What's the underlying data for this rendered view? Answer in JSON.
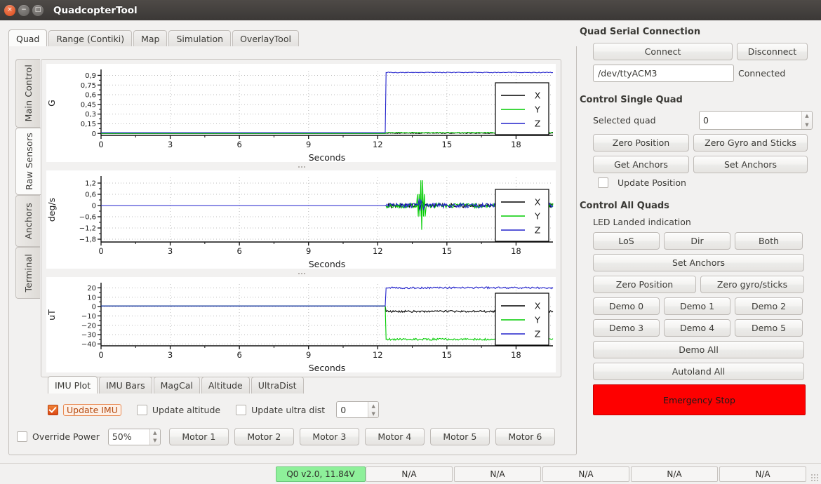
{
  "window": {
    "title": "QuadcopterTool",
    "buttons": {
      "close": "×",
      "minimize": "−",
      "maximize": "□"
    }
  },
  "top_tabs": [
    {
      "label": "Quad",
      "selected": true
    },
    {
      "label": "Range (Contiki)",
      "selected": false
    },
    {
      "label": "Map",
      "selected": false
    },
    {
      "label": "Simulation",
      "selected": false
    },
    {
      "label": "OverlayTool",
      "selected": false
    }
  ],
  "side_tabs": [
    {
      "label": "Main Control",
      "selected": false
    },
    {
      "label": "Raw Sensors",
      "selected": true
    },
    {
      "label": "Anchors",
      "selected": false
    },
    {
      "label": "Terminal",
      "selected": false
    }
  ],
  "bottom_tabs": [
    {
      "label": "IMU Plot",
      "selected": true
    },
    {
      "label": "IMU Bars",
      "selected": false
    },
    {
      "label": "MagCal",
      "selected": false
    },
    {
      "label": "Altitude",
      "selected": false
    },
    {
      "label": "UltraDist",
      "selected": false
    }
  ],
  "update_row": {
    "imu_label": "Update IMU",
    "imu_checked": true,
    "altitude_label": "Update altitude",
    "altitude_checked": false,
    "ultra_label": "Update ultra dist",
    "ultra_checked": false,
    "ultra_value": "0"
  },
  "motor_row": {
    "override_label": "Override Power",
    "override_checked": false,
    "power_value": "50%",
    "motors": [
      "Motor 1",
      "Motor 2",
      "Motor 3",
      "Motor 4",
      "Motor 5",
      "Motor 6"
    ]
  },
  "right_panel": {
    "serial": {
      "title": "Quad Serial Connection",
      "connect": "Connect",
      "disconnect": "Disconnect",
      "port_value": "/dev/ttyACM3",
      "status": "Connected"
    },
    "single": {
      "title": "Control Single Quad",
      "selected_quad_label": "Selected quad",
      "selected_quad_value": "0",
      "zero_position": "Zero Position",
      "zero_gyro_sticks": "Zero Gyro and Sticks",
      "get_anchors": "Get Anchors",
      "set_anchors": "Set Anchors",
      "update_position_label": "Update Position",
      "update_position_checked": false
    },
    "all": {
      "title": "Control All Quads",
      "led_label": "LED Landed indication",
      "los": "LoS",
      "dir": "Dir",
      "both": "Both",
      "set_anchors": "Set Anchors",
      "zero_position": "Zero Position",
      "zero_gyro_sticks": "Zero gyro/sticks",
      "demos": [
        "Demo 0",
        "Demo 1",
        "Demo 2",
        "Demo 3",
        "Demo 4",
        "Demo 5"
      ],
      "demo_all": "Demo All",
      "autoland_all": "Autoland All",
      "emergency_stop": "Emergency Stop",
      "emergency_color": "#fe0000"
    }
  },
  "status_bar": {
    "cells": [
      {
        "text": "Q0 v2.0, 11.84V",
        "ok": true
      },
      {
        "text": "N/A",
        "ok": false
      },
      {
        "text": "N/A",
        "ok": false
      },
      {
        "text": "N/A",
        "ok": false
      },
      {
        "text": "N/A",
        "ok": false
      },
      {
        "text": "N/A",
        "ok": false
      }
    ]
  },
  "chart_data": [
    {
      "type": "line",
      "title": "",
      "xlabel": "Seconds",
      "ylabel": "G",
      "xlim": [
        0,
        19.6
      ],
      "ylim": [
        -0.03,
        0.97
      ],
      "xticks": [
        0,
        3,
        6,
        9,
        12,
        15,
        18
      ],
      "xticklabels": [
        "0",
        "3",
        "6",
        "9",
        "12",
        "15",
        "18"
      ],
      "yticks": [
        0,
        0.15,
        0.3,
        0.45,
        0.6,
        0.75,
        0.9
      ],
      "yticklabels": [
        "0",
        "0,15",
        "0,3",
        "0,45",
        "0,6",
        "0,75",
        "0,9"
      ],
      "grid": true,
      "legend": [
        "X",
        "Y",
        "Z"
      ],
      "legend_position": "lower right",
      "colors": {
        "X": "#000000",
        "Y": "#00cc00",
        "Z": "#2222cc"
      },
      "step_time": 12.35,
      "series": [
        {
          "name": "X",
          "before": 0.0,
          "after": 0.005,
          "noise": 0.006
        },
        {
          "name": "Y",
          "before": 0.0,
          "after": 0.012,
          "noise": 0.006
        },
        {
          "name": "Z",
          "before": 0.012,
          "after": 0.945,
          "noise": 0.006
        }
      ]
    },
    {
      "type": "line",
      "title": "",
      "xlabel": "Seconds",
      "ylabel": "deg/s",
      "xlim": [
        0,
        19.6
      ],
      "ylim": [
        -1.95,
        1.5
      ],
      "xticks": [
        0,
        3,
        6,
        9,
        12,
        15,
        18
      ],
      "xticklabels": [
        "0",
        "3",
        "6",
        "9",
        "12",
        "15",
        "18"
      ],
      "yticks": [
        -1.8,
        -1.2,
        -0.6,
        0,
        0.6,
        1.2
      ],
      "yticklabels": [
        "−1,8",
        "−1,2",
        "−0,6",
        "0",
        "0,6",
        "1,2"
      ],
      "grid": true,
      "legend": [
        "X",
        "Y",
        "Z"
      ],
      "legend_position": "lower right",
      "colors": {
        "X": "#000000",
        "Y": "#00cc00",
        "Z": "#2222cc"
      },
      "step_time": 12.35,
      "spike": {
        "time": 13.9,
        "series": "Y",
        "high": 1.35,
        "low": -1.3
      },
      "series": [
        {
          "name": "X",
          "before": 0.0,
          "after": 0.0,
          "noise": 0.11
        },
        {
          "name": "Y",
          "before": 0.0,
          "after": 0.0,
          "noise": 0.13
        },
        {
          "name": "Z",
          "before": 0.0,
          "after": 0.0,
          "noise": 0.12
        }
      ]
    },
    {
      "type": "line",
      "title": "",
      "xlabel": "Seconds",
      "ylabel": "uT",
      "xlim": [
        0,
        19.6
      ],
      "ylim": [
        -42,
        24
      ],
      "xticks": [
        0,
        3,
        6,
        9,
        12,
        15,
        18
      ],
      "xticklabels": [
        "0",
        "3",
        "6",
        "9",
        "12",
        "15",
        "18"
      ],
      "yticks": [
        -40,
        -30,
        -20,
        -10,
        0,
        10,
        20
      ],
      "yticklabels": [
        "−40",
        "−30",
        "−20",
        "−10",
        "0",
        "10",
        "20"
      ],
      "grid": true,
      "legend": [
        "X",
        "Y",
        "Z"
      ],
      "legend_position": "lower right",
      "colors": {
        "X": "#000000",
        "Y": "#00cc00",
        "Z": "#2222cc"
      },
      "step_time": 12.35,
      "series": [
        {
          "name": "X",
          "before": 0.6,
          "after": -5.2,
          "noise": 1.0
        },
        {
          "name": "Y",
          "before": 0.6,
          "after": -35.0,
          "noise": 1.1
        },
        {
          "name": "Z",
          "before": 0.6,
          "after": 20.0,
          "noise": 1.0
        }
      ]
    }
  ]
}
